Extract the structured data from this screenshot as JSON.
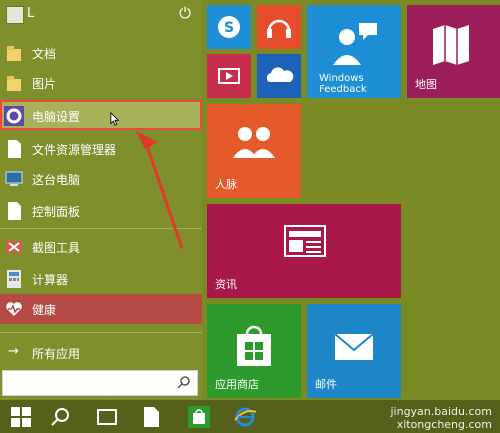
{
  "user": {
    "name": "L"
  },
  "left_items": [
    {
      "label": "文档"
    },
    {
      "label": "图片"
    },
    {
      "label": "电脑设置"
    },
    {
      "label": "文件资源管理器"
    },
    {
      "label": "这台电脑"
    },
    {
      "label": "控制面板"
    },
    {
      "label": "截图工具"
    },
    {
      "label": "计算器"
    },
    {
      "label": "健康"
    },
    {
      "label": "所有应用"
    }
  ],
  "search": {
    "placeholder": "",
    "value": ""
  },
  "tiles": {
    "skype": {
      "label": ""
    },
    "music": {
      "label": ""
    },
    "video": {
      "label": ""
    },
    "onedrive": {
      "label": ""
    },
    "feedback": {
      "label": "Windows Feedback"
    },
    "maps": {
      "label": "地图"
    },
    "people": {
      "label": "人脉"
    },
    "news": {
      "label": "资讯"
    },
    "store": {
      "label": "应用商店"
    },
    "mail": {
      "label": "邮件"
    }
  },
  "watermark": {
    "line1": "jingyan.baidu.com",
    "line2": "xitongcheng.com"
  },
  "colors": {
    "background": "#7a8a25",
    "tile_blue": "#1e8fd6",
    "tile_red": "#c72e4e",
    "tile_orange": "#e45a2a",
    "tile_purple": "#9c1f5c",
    "tile_green": "#2e9a2e",
    "tile_teal": "#1c86c8",
    "highlight_border": "#e94a3a"
  }
}
